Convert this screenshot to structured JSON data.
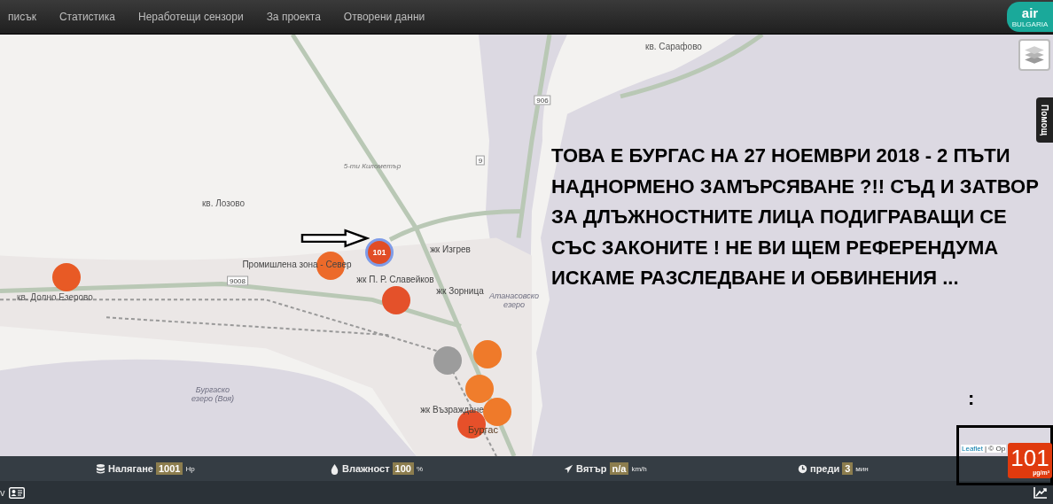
{
  "nav": {
    "items": [
      {
        "label": "писък",
        "selected": false
      },
      {
        "label": "Статистика",
        "selected": false
      },
      {
        "label": "Неработещи сензори",
        "selected": false
      },
      {
        "label": "За проекта",
        "selected": false
      },
      {
        "label": "Отворени данни",
        "selected": false
      }
    ],
    "logo": {
      "text": "air",
      "subtitle": "BULGARIA"
    }
  },
  "map": {
    "labels": [
      {
        "text": "кв. Сарафово",
        "kind": "area"
      },
      {
        "text": "906",
        "kind": "shield"
      },
      {
        "text": "9",
        "kind": "shield"
      },
      {
        "text": "5-ти Километър",
        "kind": "street"
      },
      {
        "text": "кв. Лозово",
        "kind": "area"
      },
      {
        "text": "жк Изгрев",
        "kind": "district"
      },
      {
        "text": "кв. Долно Езерово",
        "kind": "area"
      },
      {
        "text": "9008",
        "kind": "shield"
      },
      {
        "text": "Промишлена зона - Север",
        "kind": "district"
      },
      {
        "text": "жк П. Р. Славейков",
        "kind": "district"
      },
      {
        "text": "жк Зорница",
        "kind": "district"
      },
      {
        "text": "Атанасовско езеро",
        "kind": "water"
      },
      {
        "text": "Бургаско езеро (Воя)",
        "kind": "water"
      },
      {
        "text": "жк Възраждане",
        "kind": "district"
      },
      {
        "text": "Бургас",
        "kind": "city"
      }
    ],
    "markers": [
      {
        "color": "#e85a25"
      },
      {
        "color": "#ec6a2a"
      },
      {
        "color": "#e4512a"
      },
      {
        "color": "#9c9c9c"
      },
      {
        "color": "#ef7a2a"
      },
      {
        "color": "#f07d2c"
      },
      {
        "color": "#ef7a2a"
      },
      {
        "color": "#e6502a"
      }
    ],
    "selected_marker": {
      "value": "101",
      "color": "#e14d26"
    },
    "annotation": "ТОВА Е БУРГАС НА 27 НОЕМВРИ 2018 - 2 ПЪТИ НАДНОРМЕНО ЗАМЪРСЯВАНЕ ?!! СЪД И ЗАТВОР ЗА ДЛЪЖНОСТНИТЕ ЛИЦА ПОДИГРАВАЩИ СЕ СЪС ЗАКОНИТЕ ! НЕ ВИ ЩЕМ РЕФЕРЕНДУМА ИСКАМЕ РАЗСЛЕДВАНЕ И ОБВИНЕНИЯ ...",
    "annotation_mark": ":",
    "help_tab": "Помощ",
    "attribution": {
      "link": "Leaflet",
      "rest": "| © Op"
    }
  },
  "stats": [
    {
      "kind": "pressure",
      "label": "Налягане",
      "value": "1001",
      "unit": "Hp"
    },
    {
      "kind": "humidity",
      "label": "Влажност",
      "value": "100",
      "unit": "%"
    },
    {
      "kind": "wind",
      "label": "Вятър",
      "value": "n/a",
      "unit": "km/h"
    },
    {
      "kind": "time",
      "label": "преди",
      "value": "3",
      "unit": "мин"
    }
  ],
  "aqi": {
    "value": "101",
    "unit": "µg/m³",
    "color": "#e03a0e"
  },
  "bottom": {
    "left_text": "v"
  }
}
